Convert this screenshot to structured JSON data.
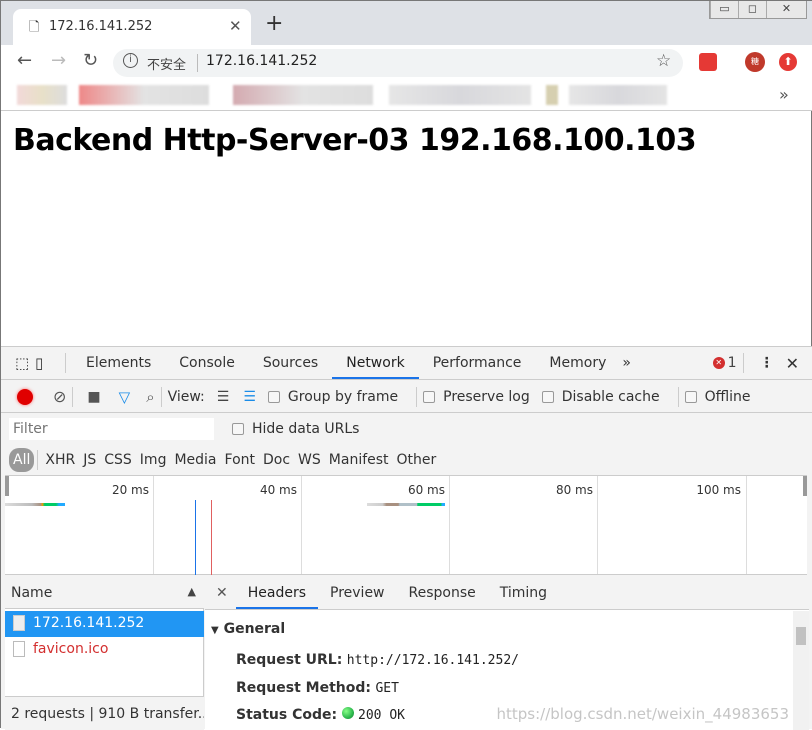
{
  "browser": {
    "tab_title": "172.16.141.252",
    "window_controls": [
      "minimize",
      "maximize",
      "close"
    ],
    "security_label": "不安全",
    "url": "172.16.141.252",
    "bookmarks_more": "»",
    "extension_badge": "糖"
  },
  "page": {
    "heading": "Backend Http-Server-03 192.168.100.103"
  },
  "devtools": {
    "tabs": [
      "Elements",
      "Console",
      "Sources",
      "Network",
      "Performance",
      "Memory"
    ],
    "active_tab": "Network",
    "more": "»",
    "error_count": "1",
    "toolbar": {
      "view_label": "View:",
      "group_by_frame": "Group by frame",
      "preserve_log": "Preserve log",
      "disable_cache": "Disable cache",
      "offline": "Offline"
    },
    "filter_placeholder": "Filter",
    "hide_data_urls": "Hide data URLs",
    "type_filters": [
      "All",
      "XHR",
      "JS",
      "CSS",
      "Img",
      "Media",
      "Font",
      "Doc",
      "WS",
      "Manifest",
      "Other"
    ],
    "timeline_ticks": [
      "20 ms",
      "40 ms",
      "60 ms",
      "80 ms",
      "100 ms"
    ],
    "name_header": "Name",
    "requests": [
      {
        "name": "172.16.141.252",
        "selected": true
      },
      {
        "name": "favicon.ico",
        "error": true
      }
    ],
    "summary": "2 requests | 910 B transfer...",
    "detail_tabs": [
      "Headers",
      "Preview",
      "Response",
      "Timing"
    ],
    "general_title": "General",
    "general": [
      {
        "label": "Request URL:",
        "value": "http://172.16.141.252/"
      },
      {
        "label": "Request Method:",
        "value": "GET"
      },
      {
        "label": "Status Code:",
        "value": "200 OK"
      }
    ],
    "colors": {
      "accent": "#1a73e8",
      "selected_row": "#2196f3",
      "error": "#d32f2f",
      "status_ok": "#2db84d",
      "record": "#e00000"
    }
  },
  "watermark": "https://blog.csdn.net/weixin_44983653"
}
